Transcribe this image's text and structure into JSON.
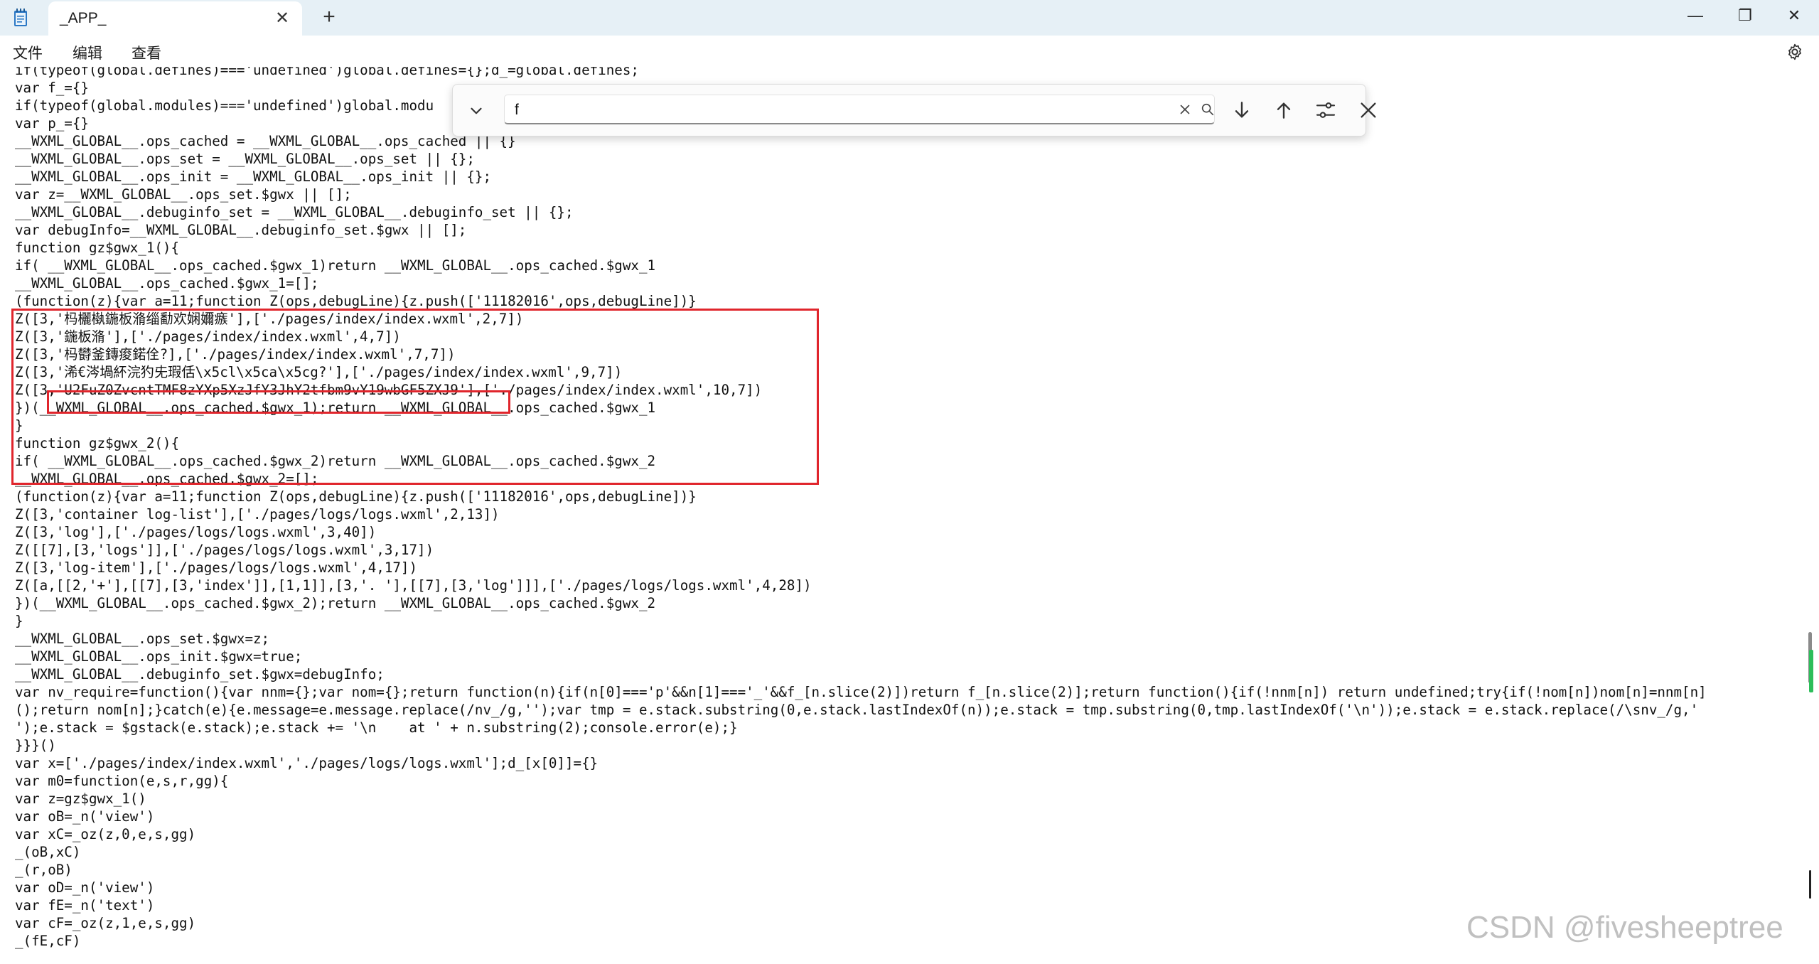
{
  "window": {
    "tab_title": "_APP_",
    "close_tab_glyph": "✕",
    "new_tab_glyph": "+",
    "minimize_glyph": "—",
    "maximize_glyph": "❐",
    "close_glyph": "✕"
  },
  "menu": {
    "items": [
      "文件",
      "编辑",
      "查看"
    ]
  },
  "find": {
    "value": "f",
    "placeholder": ""
  },
  "code_lines": [
    "if(typeof(global.defines)==='undefined')global.defines={};d_=global.defines;",
    "var f_={}",
    "if(typeof(global.modules)==='undefined')global.modu",
    "var p_={}",
    "__WXML_GLOBAL__.ops_cached = __WXML_GLOBAL__.ops_cached || {}",
    "__WXML_GLOBAL__.ops_set = __WXML_GLOBAL__.ops_set || {};",
    "__WXML_GLOBAL__.ops_init = __WXML_GLOBAL__.ops_init || {};",
    "var z=__WXML_GLOBAL__.ops_set.$gwx || [];",
    "__WXML_GLOBAL__.debuginfo_set = __WXML_GLOBAL__.debuginfo_set || {};",
    "var debugInfo=__WXML_GLOBAL__.debuginfo_set.$gwx || [];",
    "function gz$gwx_1(){",
    "if( __WXML_GLOBAL__.ops_cached.$gwx_1)return __WXML_GLOBAL__.ops_cached.$gwx_1",
    "__WXML_GLOBAL__.ops_cached.$gwx_1=[];",
    "(function(z){var a=11;function Z(ops,debugLine){z.push(['11182016',ops,debugLine])}",
    "Z([3,'杩欐槸鍦板潃缁勫欢娴嬭瘯'],['./pages/index/index.wxml',2,7])",
    "Z([3,'鍦板潃'],['./pages/index/index.wxml',4,7])",
    "Z([3,'杩欎釜鏄痠鍩佺?],['./pages/index/index.wxml',7,7])",
    "Z([3,'浠€涔堝紑浣犳兂瑕佸\\x5cl\\x5ca\\x5cg?'],['./pages/index/index.wxml',9,7])",
    "Z([3,'U2FuZ0ZvcntTMF8zYXp5XzJfY3JhY2tfbm9vY19wbGF5ZXJ9'],['./pages/index/index.wxml',10,7])",
    "})(__WXML_GLOBAL__.ops_cached.$gwx_1);return __WXML_GLOBAL__.ops_cached.$gwx_1",
    "}",
    "function gz$gwx_2(){",
    "if( __WXML_GLOBAL__.ops_cached.$gwx_2)return __WXML_GLOBAL__.ops_cached.$gwx_2",
    "__WXML_GLOBAL__.ops_cached.$gwx_2=[];",
    "(function(z){var a=11;function Z(ops,debugLine){z.push(['11182016',ops,debugLine])}",
    "Z([3,'container log-list'],['./pages/logs/logs.wxml',2,13])",
    "Z([3,'log'],['./pages/logs/logs.wxml',3,40])",
    "Z([[7],[3,'logs']],['./pages/logs/logs.wxml',3,17])",
    "Z([3,'log-item'],['./pages/logs/logs.wxml',4,17])",
    "Z([a,[[2,'+'],[[7],[3,'index']],[1,1]],[3,'. '],[[7],[3,'log']]],['./pages/logs/logs.wxml',4,28])",
    "})(__WXML_GLOBAL__.ops_cached.$gwx_2);return __WXML_GLOBAL__.ops_cached.$gwx_2",
    "}",
    "__WXML_GLOBAL__.ops_set.$gwx=z;",
    "__WXML_GLOBAL__.ops_init.$gwx=true;",
    "__WXML_GLOBAL__.debuginfo_set.$gwx=debugInfo;",
    "var nv_require=function(){var nnm={};var nom={};return function(n){if(n[0]==='p'&&n[1]==='_'&&f_[n.slice(2)])return f_[n.slice(2)];return function(){if(!nnm[n]) return undefined;try{if(!nom[n])nom[n]=nnm[n]",
    "();return nom[n];}catch(e){e.message=e.message.replace(/nv_/g,'');var tmp = e.stack.substring(0,e.stack.lastIndexOf(n));e.stack = tmp.substring(0,tmp.lastIndexOf('\\n'));e.stack = e.stack.replace(/\\snv_/g,'",
    "');e.stack = $gstack(e.stack);e.stack += '\\n    at ' + n.substring(2);console.error(e);}",
    "}}}()",
    "var x=['./pages/index/index.wxml','./pages/logs/logs.wxml'];d_[x[0]]={}",
    "var m0=function(e,s,r,gg){",
    "var z=gz$gwx_1()",
    "var oB=_n('view')",
    "var xC=_oz(z,0,e,s,gg)",
    "_(oB,xC)",
    "_(r,oB)",
    "var oD=_n('view')",
    "var fE=_n('text')",
    "var cF=_oz(z,1,e,s,gg)",
    "_(fE,cF)"
  ],
  "watermark": "CSDN @fivesheeptree",
  "colors": {
    "highlight_box": "#e0252c",
    "titlebar_bg": "#e6f0f6",
    "scroll_marker": "#2dbd5a"
  },
  "icons": {
    "app": "notepad-icon",
    "settings": "gear-icon",
    "find_expand": "chevron-down-icon",
    "find_clear": "clear-icon",
    "find_search": "search-icon",
    "find_next": "arrow-down-icon",
    "find_prev": "arrow-up-icon",
    "find_options": "sliders-icon",
    "find_close": "close-icon"
  }
}
